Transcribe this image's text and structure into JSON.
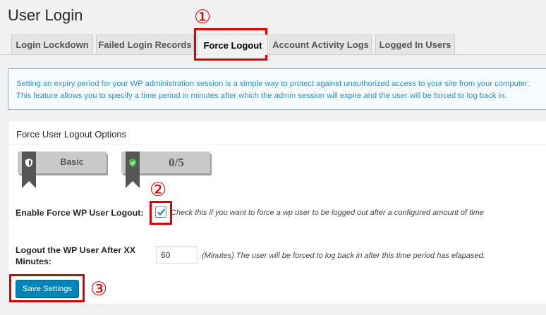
{
  "page": {
    "title": "User Login"
  },
  "tabs": [
    {
      "label": "Login Lockdown"
    },
    {
      "label": "Failed Login Records"
    },
    {
      "label": "Force Logout",
      "active": true
    },
    {
      "label": "Account Activity Logs"
    },
    {
      "label": "Logged In Users"
    }
  ],
  "notice": {
    "line1": "Setting an expiry period for your WP administration session is a simple way to protect against unauthorized access to your site from your computer.",
    "line2": "This feature allows you to specify a time period in minutes after which the admin session will expire and the user will be forced to log back in."
  },
  "section": {
    "title": "Force User Logout Options",
    "badge_level": "Basic",
    "badge_points": "0/5"
  },
  "force_logout": {
    "label": "Enable Force WP User Logout:",
    "checked": true,
    "help": "Check this if you want to force a wp user to be logged out after a configured amount of time"
  },
  "logout_after": {
    "label_line1": "Logout the WP User After XX",
    "label_line2": "Minutes:",
    "value": "60",
    "help": "(Minutes) The user will be forced to log back in after this time period has elapased."
  },
  "save_button": {
    "label": "Save Settings"
  },
  "callouts": [
    "①",
    "②",
    "③"
  ],
  "colors": {
    "accent": "#0085ba",
    "callout": "#e10000",
    "notice_text": "#2e8fcf",
    "check": "#1e8cbe"
  },
  "icons": [
    "shield-icon",
    "shield-check-icon",
    "checkmark-icon"
  ]
}
